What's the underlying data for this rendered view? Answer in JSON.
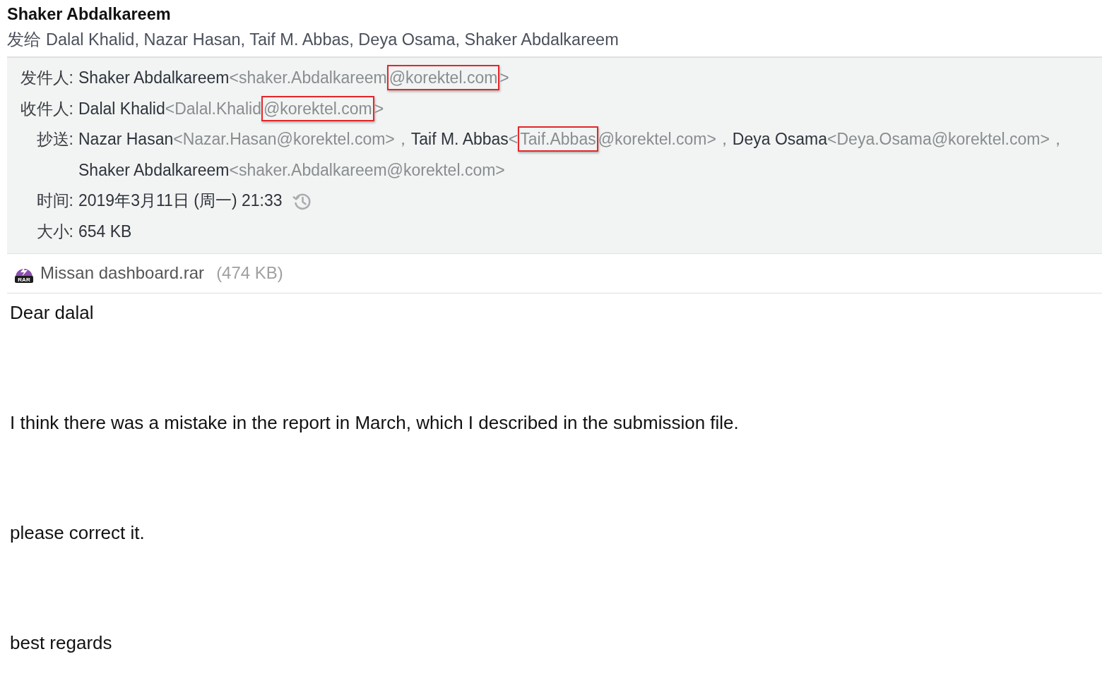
{
  "message": {
    "sender_name": "Shaker Abdalkareem",
    "recipients_summary": {
      "label": "发给",
      "names": "Dalal Khalid, Nazar Hasan, Taif M. Abbas, Deya Osama, Shaker Abdalkareem"
    }
  },
  "details": [
    {
      "kind": "contacts",
      "label": "发件人:",
      "contacts": [
        {
          "name": "Shaker Abdalkareem",
          "address_parts": [
            {
              "text": "<shaker.Abdalkareem",
              "highlighted": false
            },
            {
              "text": "@korektel.com",
              "highlighted": true
            },
            {
              "text": ">",
              "highlighted": false
            }
          ]
        }
      ]
    },
    {
      "kind": "contacts",
      "label": "收件人:",
      "contacts": [
        {
          "name": "Dalal Khalid",
          "address_parts": [
            {
              "text": "<Dalal.Khalid",
              "highlighted": false
            },
            {
              "text": "@korektel.com",
              "highlighted": true
            },
            {
              "text": ">",
              "highlighted": false
            }
          ]
        }
      ]
    },
    {
      "kind": "contacts",
      "label": "抄送:",
      "contacts": [
        {
          "name": "Nazar Hasan",
          "address_parts": [
            {
              "text": "<Nazar.Hasan@korektel.com>，",
              "highlighted": false
            }
          ]
        },
        {
          "name": "Taif M. Abbas",
          "address_parts": [
            {
              "text": "<",
              "highlighted": false
            },
            {
              "text": "Taif.Abbas",
              "highlighted": true
            },
            {
              "text": "@korektel.com>，",
              "highlighted": false
            }
          ]
        },
        {
          "name": "Deya Osama",
          "address_parts": [
            {
              "text": "<Deya.Osama@korektel.com>，",
              "highlighted": false
            }
          ]
        },
        {
          "name": "Shaker Abdalkareem",
          "address_parts": [
            {
              "text": "<shaker.Abdalkareem@korektel.com>",
              "highlighted": false
            }
          ]
        }
      ]
    },
    {
      "kind": "time",
      "label": "时间:",
      "value": "2019年3月11日 (周一) 21:33"
    },
    {
      "kind": "text",
      "label": "大小:",
      "value": "654 KB"
    }
  ],
  "attachments": [
    {
      "icon_text": "RAR",
      "name": "Missan dashboard.rar",
      "size": "(474 KB)"
    }
  ],
  "body": {
    "paragraphs": [
      "Dear dalal",
      "I think there was a mistake in the report in March, which I described in the submission file.",
      "please correct it.",
      "best regards"
    ]
  }
}
